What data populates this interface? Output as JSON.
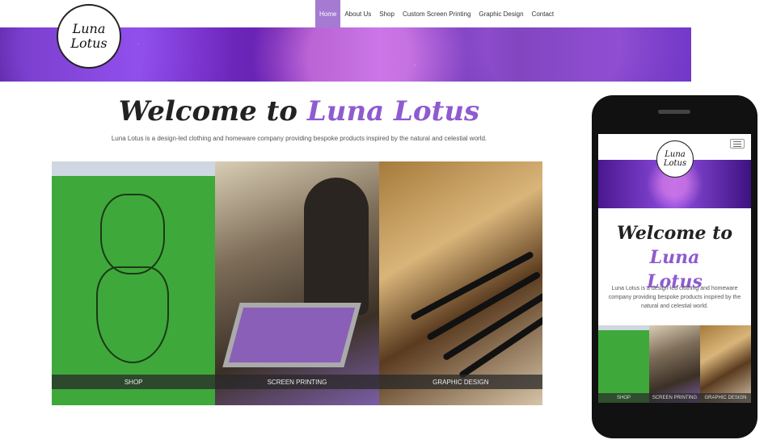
{
  "desktop": {
    "nav": [
      {
        "label": "Home",
        "active": true
      },
      {
        "label": "About Us",
        "active": false
      },
      {
        "label": "Shop",
        "active": false
      },
      {
        "label": "Custom Screen Printing",
        "active": false
      },
      {
        "label": "Graphic Design",
        "active": false
      },
      {
        "label": "Contact",
        "active": false
      }
    ],
    "logo": {
      "line1": "Luna",
      "line2": "Lotus"
    },
    "welcome": {
      "prefix": "Welcome to ",
      "accent": "Luna Lotus"
    },
    "intro": "Luna Lotus is a design-led clothing and homeware company providing bespoke products inspired by the natural and celestial world.",
    "tiles": [
      {
        "label": "SHOP"
      },
      {
        "label": "SCREEN PRINTING"
      },
      {
        "label": "GRAPHIC DESIGN"
      }
    ]
  },
  "mobile": {
    "logo": {
      "line1": "Luna",
      "line2": "Lotus"
    },
    "welcome": {
      "prefix": "Welcome to ",
      "accent_line1": "Luna",
      "accent_line2": "Lotus"
    },
    "intro": "Luna Lotus is a design-led clothing and homeware company providing bespoke products inspired by the natural and celestial world.",
    "tiles": [
      {
        "label": "SHOP"
      },
      {
        "label": "SCREEN PRINTING"
      },
      {
        "label": "GRAPHIC DESIGN"
      }
    ]
  },
  "colors": {
    "accent": "#8e5bd0",
    "nav_active": "#a57ad2"
  },
  "icons": [
    "hamburger-menu-icon"
  ]
}
